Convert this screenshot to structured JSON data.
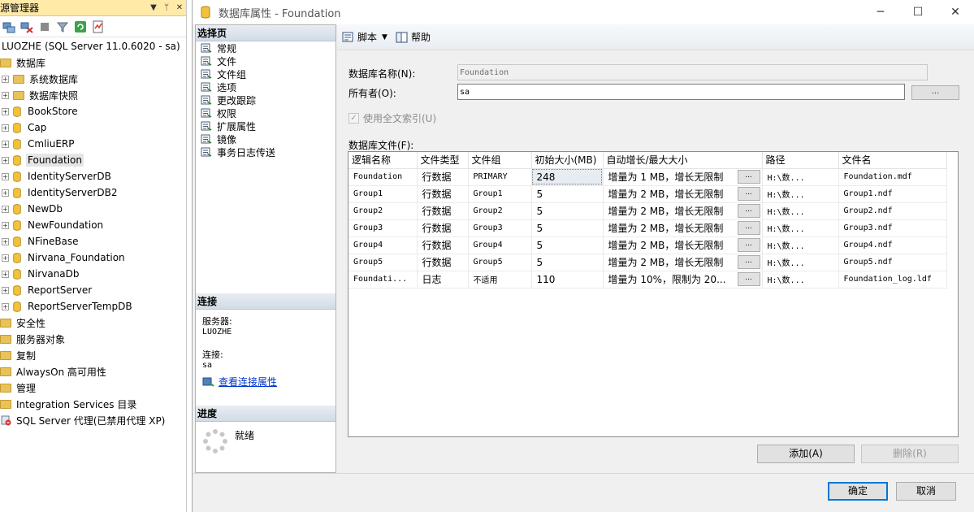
{
  "object_explorer": {
    "title": "资源管理器",
    "title_visible": "源管理器",
    "server": "LUOZHE (SQL Server 11.0.6020 - sa)",
    "databases_label": "数据库",
    "system_dbs": "系统数据库",
    "snapshots": "数据库快照",
    "databases": [
      "BookStore",
      "Cap",
      "CmliuERP",
      "Foundation",
      "IdentityServerDB",
      "IdentityServerDB2",
      "NewDb",
      "NewFoundation",
      "NFineBase",
      "Nirvana_Foundation",
      "NirvanaDb",
      "ReportServer",
      "ReportServerTempDB"
    ],
    "selected_database": "Foundation",
    "folders": [
      "安全性",
      "服务器对象",
      "复制",
      "AlwaysOn 高可用性",
      "管理",
      "Integration Services 目录"
    ],
    "agent": "SQL Server 代理(已禁用代理 XP)"
  },
  "dialog": {
    "title": "数据库属性 - Foundation",
    "select_page_header": "选择页",
    "pages": [
      "常规",
      "文件",
      "文件组",
      "选项",
      "更改跟踪",
      "权限",
      "扩展属性",
      "镜像",
      "事务日志传送"
    ],
    "connection_header": "连接",
    "server_label": "服务器:",
    "server_value": "LUOZHE",
    "conn_label": "连接:",
    "conn_value": "sa",
    "view_conn_props": "查看连接属性",
    "progress_header": "进度",
    "progress_status": "就绪",
    "toolbar": {
      "script": "脚本",
      "help": "帮助"
    },
    "db_name_label": "数据库名称(N):",
    "db_name_value": "Foundation",
    "owner_label": "所有者(O):",
    "owner_value": "sa",
    "browse_label": "...",
    "fulltext_label": "使用全文索引(U)",
    "files_label": "数据库文件(F):",
    "columns": [
      "逻辑名称",
      "文件类型",
      "文件组",
      "初始大小(MB)",
      "自动增长/最大大小",
      "路径",
      "文件名"
    ],
    "rows": [
      [
        "Foundation",
        "行数据",
        "PRIMARY",
        "248",
        "增量为 1 MB，增长无限制",
        "H:\\数...",
        "Foundation.mdf"
      ],
      [
        "Group1",
        "行数据",
        "Group1",
        "5",
        "增量为 2 MB，增长无限制",
        "H:\\数...",
        "Group1.ndf"
      ],
      [
        "Group2",
        "行数据",
        "Group2",
        "5",
        "增量为 2 MB，增长无限制",
        "H:\\数...",
        "Group2.ndf"
      ],
      [
        "Group3",
        "行数据",
        "Group3",
        "5",
        "增量为 2 MB，增长无限制",
        "H:\\数...",
        "Group3.ndf"
      ],
      [
        "Group4",
        "行数据",
        "Group4",
        "5",
        "增量为 2 MB，增长无限制",
        "H:\\数...",
        "Group4.ndf"
      ],
      [
        "Group5",
        "行数据",
        "Group5",
        "5",
        "增量为 2 MB，增长无限制",
        "H:\\数...",
        "Group5.ndf"
      ],
      [
        "Foundati...",
        "日志",
        "不适用",
        "110",
        "增量为 10%，限制为 20...",
        "H:\\数...",
        "Foundation_log.ldf"
      ]
    ],
    "add_button": "添加(A)",
    "delete_button": "删除(R)",
    "ok_button": "确定",
    "cancel_button": "取消"
  }
}
